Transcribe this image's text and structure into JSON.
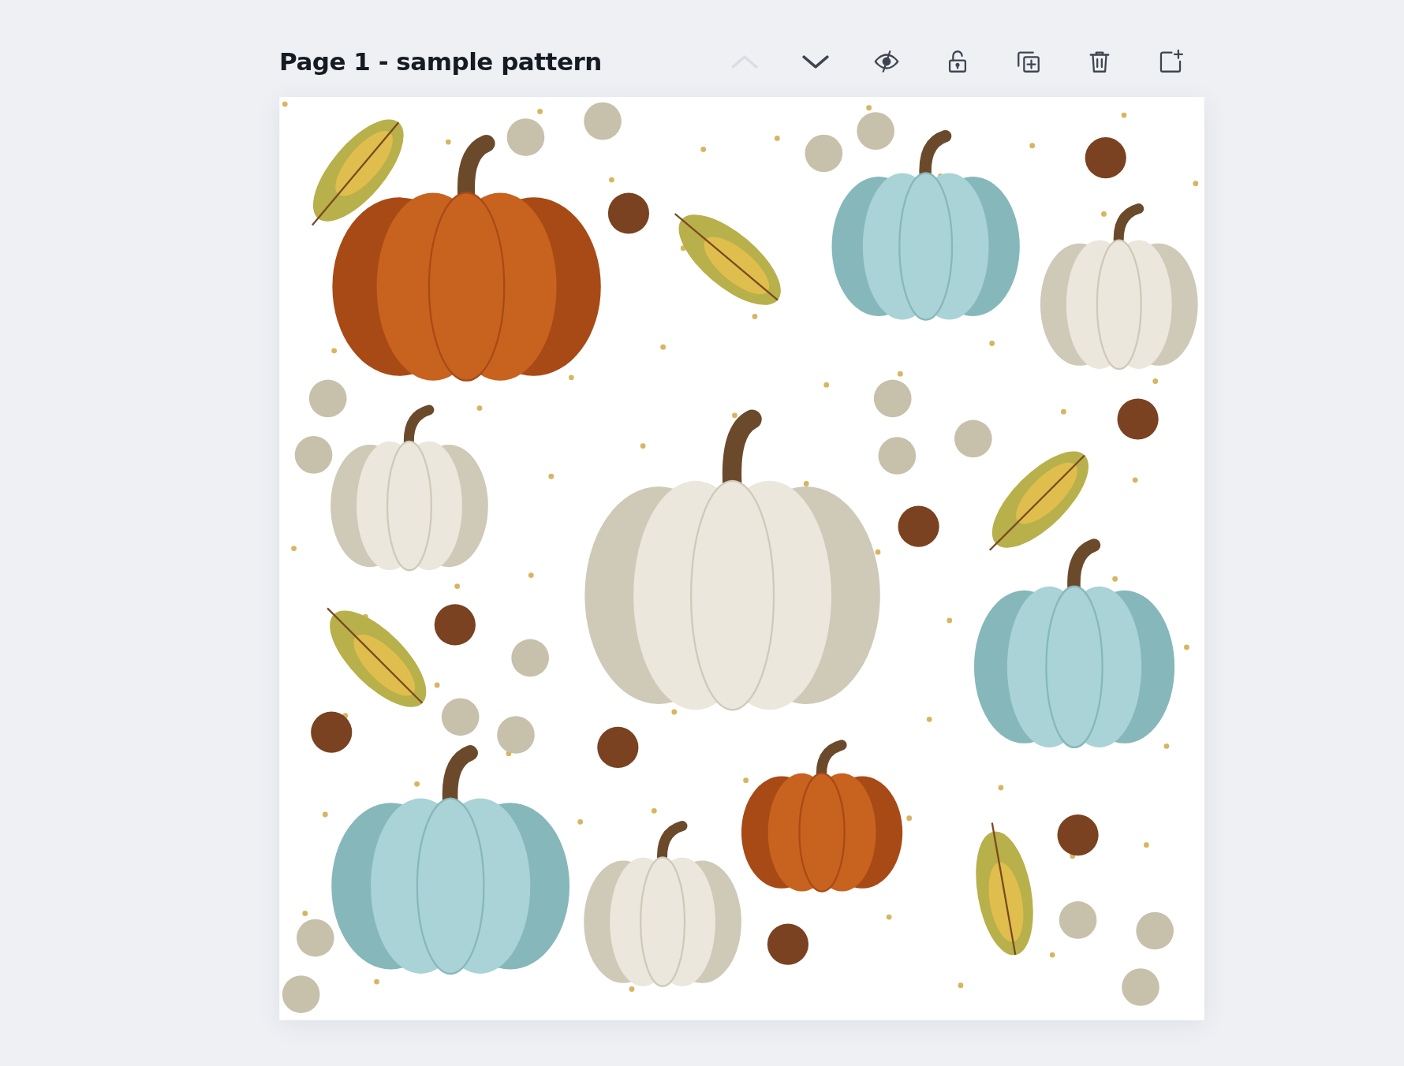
{
  "page": {
    "title": "Page 1 - sample pattern"
  },
  "toolbar": [
    {
      "kind": "up",
      "disabled": true
    },
    {
      "kind": "down",
      "disabled": false
    },
    {
      "kind": "hide",
      "disabled": false
    },
    {
      "kind": "lock",
      "disabled": false
    },
    {
      "kind": "duplicate",
      "disabled": false
    },
    {
      "kind": "delete",
      "disabled": false
    },
    {
      "kind": "add",
      "disabled": false
    }
  ]
}
